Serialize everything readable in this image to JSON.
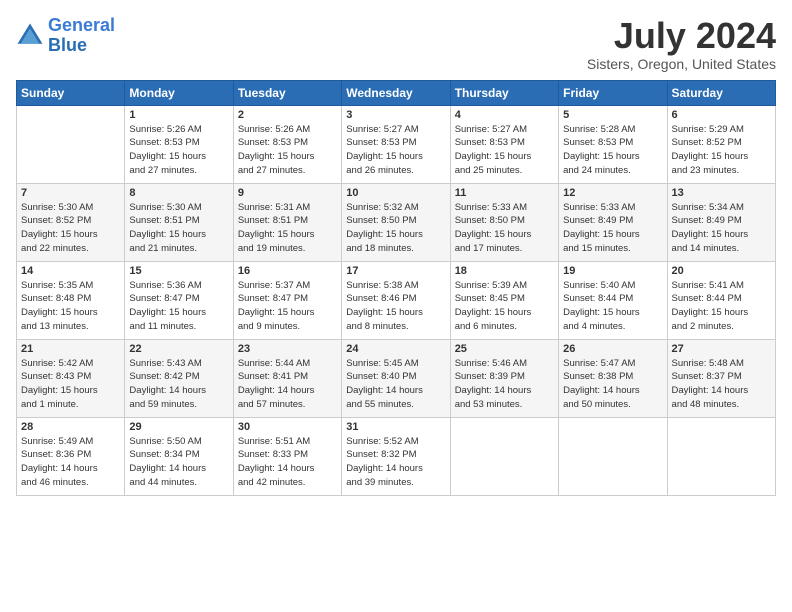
{
  "header": {
    "logo_line1": "General",
    "logo_line2": "Blue",
    "title": "July 2024",
    "location": "Sisters, Oregon, United States"
  },
  "calendar": {
    "days_of_week": [
      "Sunday",
      "Monday",
      "Tuesday",
      "Wednesday",
      "Thursday",
      "Friday",
      "Saturday"
    ],
    "weeks": [
      [
        {
          "num": "",
          "info": ""
        },
        {
          "num": "1",
          "info": "Sunrise: 5:26 AM\nSunset: 8:53 PM\nDaylight: 15 hours\nand 27 minutes."
        },
        {
          "num": "2",
          "info": "Sunrise: 5:26 AM\nSunset: 8:53 PM\nDaylight: 15 hours\nand 27 minutes."
        },
        {
          "num": "3",
          "info": "Sunrise: 5:27 AM\nSunset: 8:53 PM\nDaylight: 15 hours\nand 26 minutes."
        },
        {
          "num": "4",
          "info": "Sunrise: 5:27 AM\nSunset: 8:53 PM\nDaylight: 15 hours\nand 25 minutes."
        },
        {
          "num": "5",
          "info": "Sunrise: 5:28 AM\nSunset: 8:53 PM\nDaylight: 15 hours\nand 24 minutes."
        },
        {
          "num": "6",
          "info": "Sunrise: 5:29 AM\nSunset: 8:52 PM\nDaylight: 15 hours\nand 23 minutes."
        }
      ],
      [
        {
          "num": "7",
          "info": "Sunrise: 5:30 AM\nSunset: 8:52 PM\nDaylight: 15 hours\nand 22 minutes."
        },
        {
          "num": "8",
          "info": "Sunrise: 5:30 AM\nSunset: 8:51 PM\nDaylight: 15 hours\nand 21 minutes."
        },
        {
          "num": "9",
          "info": "Sunrise: 5:31 AM\nSunset: 8:51 PM\nDaylight: 15 hours\nand 19 minutes."
        },
        {
          "num": "10",
          "info": "Sunrise: 5:32 AM\nSunset: 8:50 PM\nDaylight: 15 hours\nand 18 minutes."
        },
        {
          "num": "11",
          "info": "Sunrise: 5:33 AM\nSunset: 8:50 PM\nDaylight: 15 hours\nand 17 minutes."
        },
        {
          "num": "12",
          "info": "Sunrise: 5:33 AM\nSunset: 8:49 PM\nDaylight: 15 hours\nand 15 minutes."
        },
        {
          "num": "13",
          "info": "Sunrise: 5:34 AM\nSunset: 8:49 PM\nDaylight: 15 hours\nand 14 minutes."
        }
      ],
      [
        {
          "num": "14",
          "info": "Sunrise: 5:35 AM\nSunset: 8:48 PM\nDaylight: 15 hours\nand 13 minutes."
        },
        {
          "num": "15",
          "info": "Sunrise: 5:36 AM\nSunset: 8:47 PM\nDaylight: 15 hours\nand 11 minutes."
        },
        {
          "num": "16",
          "info": "Sunrise: 5:37 AM\nSunset: 8:47 PM\nDaylight: 15 hours\nand 9 minutes."
        },
        {
          "num": "17",
          "info": "Sunrise: 5:38 AM\nSunset: 8:46 PM\nDaylight: 15 hours\nand 8 minutes."
        },
        {
          "num": "18",
          "info": "Sunrise: 5:39 AM\nSunset: 8:45 PM\nDaylight: 15 hours\nand 6 minutes."
        },
        {
          "num": "19",
          "info": "Sunrise: 5:40 AM\nSunset: 8:44 PM\nDaylight: 15 hours\nand 4 minutes."
        },
        {
          "num": "20",
          "info": "Sunrise: 5:41 AM\nSunset: 8:44 PM\nDaylight: 15 hours\nand 2 minutes."
        }
      ],
      [
        {
          "num": "21",
          "info": "Sunrise: 5:42 AM\nSunset: 8:43 PM\nDaylight: 15 hours\nand 1 minute."
        },
        {
          "num": "22",
          "info": "Sunrise: 5:43 AM\nSunset: 8:42 PM\nDaylight: 14 hours\nand 59 minutes."
        },
        {
          "num": "23",
          "info": "Sunrise: 5:44 AM\nSunset: 8:41 PM\nDaylight: 14 hours\nand 57 minutes."
        },
        {
          "num": "24",
          "info": "Sunrise: 5:45 AM\nSunset: 8:40 PM\nDaylight: 14 hours\nand 55 minutes."
        },
        {
          "num": "25",
          "info": "Sunrise: 5:46 AM\nSunset: 8:39 PM\nDaylight: 14 hours\nand 53 minutes."
        },
        {
          "num": "26",
          "info": "Sunrise: 5:47 AM\nSunset: 8:38 PM\nDaylight: 14 hours\nand 50 minutes."
        },
        {
          "num": "27",
          "info": "Sunrise: 5:48 AM\nSunset: 8:37 PM\nDaylight: 14 hours\nand 48 minutes."
        }
      ],
      [
        {
          "num": "28",
          "info": "Sunrise: 5:49 AM\nSunset: 8:36 PM\nDaylight: 14 hours\nand 46 minutes."
        },
        {
          "num": "29",
          "info": "Sunrise: 5:50 AM\nSunset: 8:34 PM\nDaylight: 14 hours\nand 44 minutes."
        },
        {
          "num": "30",
          "info": "Sunrise: 5:51 AM\nSunset: 8:33 PM\nDaylight: 14 hours\nand 42 minutes."
        },
        {
          "num": "31",
          "info": "Sunrise: 5:52 AM\nSunset: 8:32 PM\nDaylight: 14 hours\nand 39 minutes."
        },
        {
          "num": "",
          "info": ""
        },
        {
          "num": "",
          "info": ""
        },
        {
          "num": "",
          "info": ""
        }
      ]
    ]
  }
}
